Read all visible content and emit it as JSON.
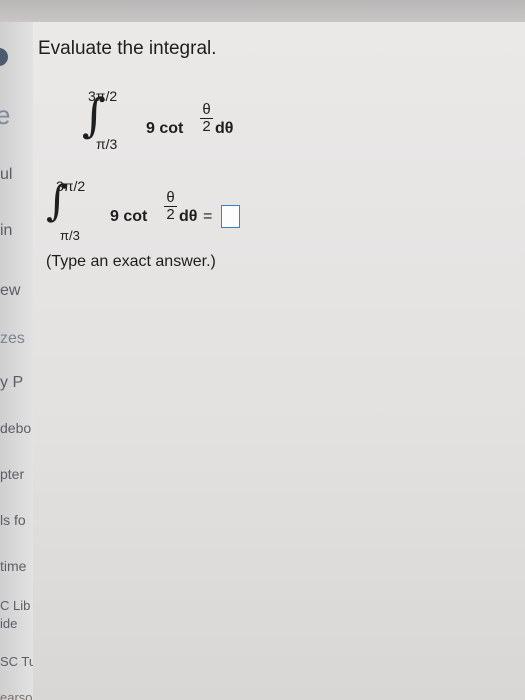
{
  "sidebar": {
    "fragments": [
      {
        "key": "ul",
        "text": "ul"
      },
      {
        "key": "ind",
        "text": "in"
      },
      {
        "key": "ewo",
        "text": "ew"
      },
      {
        "key": "zes",
        "text": "zes"
      },
      {
        "key": "ypl",
        "text": "y P"
      },
      {
        "key": "debo",
        "text": "debo"
      },
      {
        "key": "pter",
        "text": "pter"
      },
      {
        "key": "isfo",
        "text": "ls fo"
      },
      {
        "key": "time",
        "text": "time"
      },
      {
        "key": "cli",
        "text": "C Lib"
      },
      {
        "key": "ide",
        "text": "ide"
      },
      {
        "key": "sctu",
        "text": "SC Tu"
      },
      {
        "key": "earson",
        "text": "earson"
      }
    ]
  },
  "question": {
    "title": "Evaluate the integral.",
    "integral": {
      "upper": "3π/2",
      "lower": "π/3",
      "coefficient": "9 cot",
      "frac_num": "θ",
      "frac_den": "2",
      "differential": "dθ"
    },
    "answer_row": {
      "upper": "3π/2",
      "lower": "π/3",
      "coefficient": "9 cot",
      "frac_num": "θ",
      "frac_den": "2",
      "differential": "dθ",
      "equals": "=",
      "answer_value": ""
    },
    "instruction": "(Type an exact answer.)"
  }
}
